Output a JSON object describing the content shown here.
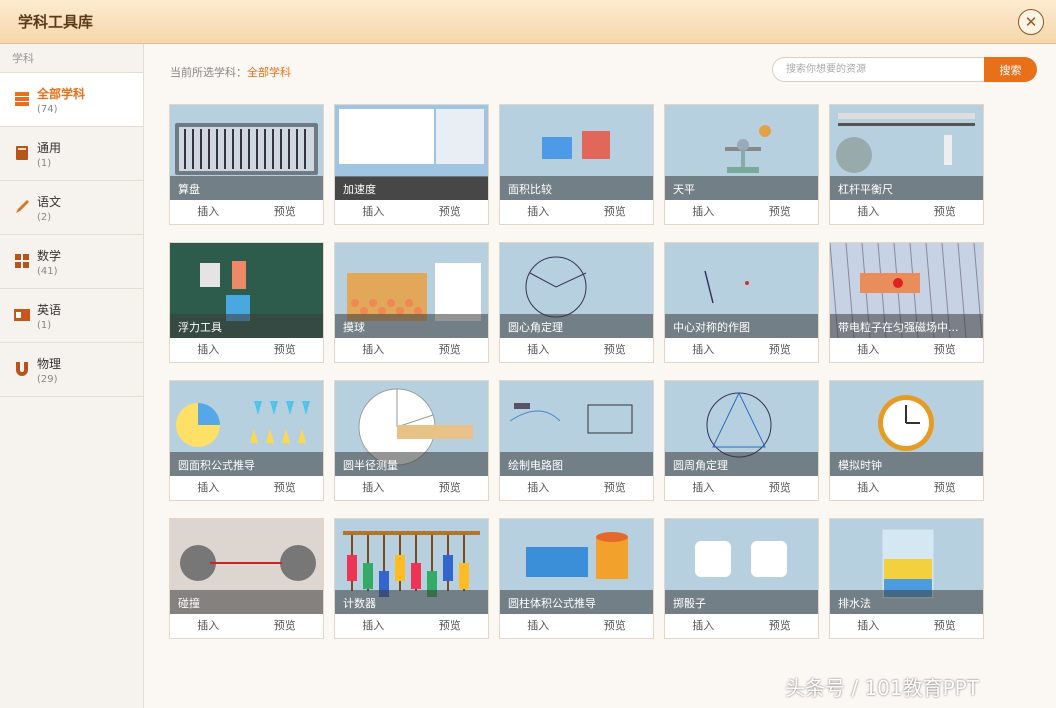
{
  "window": {
    "title": "学科工具库"
  },
  "sidebar": {
    "heading": "学科",
    "items": [
      {
        "label": "全部学科",
        "count": "(74)",
        "icon": "stack-icon"
      },
      {
        "label": "通用",
        "count": "(1)",
        "icon": "book-icon"
      },
      {
        "label": "语文",
        "count": "(2)",
        "icon": "pen-icon"
      },
      {
        "label": "数学",
        "count": "(41)",
        "icon": "calculator-icon"
      },
      {
        "label": "英语",
        "count": "(1)",
        "icon": "english-icon"
      },
      {
        "label": "物理",
        "count": "(29)",
        "icon": "magnet-icon"
      }
    ]
  },
  "breadcrumb": {
    "prefix": "当前所选学科：",
    "value": "全部学科"
  },
  "search": {
    "placeholder": "搜索你想要的资源",
    "button": "搜索"
  },
  "actions": {
    "insert": "插入",
    "preview": "预览"
  },
  "tools": [
    {
      "name": "算盘"
    },
    {
      "name": "加速度"
    },
    {
      "name": "面积比较"
    },
    {
      "name": "天平"
    },
    {
      "name": "杠杆平衡尺"
    },
    {
      "name": "浮力工具"
    },
    {
      "name": "摸球"
    },
    {
      "name": "圆心角定理"
    },
    {
      "name": "中心对称的作图"
    },
    {
      "name": "带电粒子在匀强磁场中..."
    },
    {
      "name": "圆面积公式推导"
    },
    {
      "name": "圆半径测量"
    },
    {
      "name": "绘制电路图"
    },
    {
      "name": "圆周角定理"
    },
    {
      "name": "模拟时钟"
    },
    {
      "name": "碰撞"
    },
    {
      "name": "计数器"
    },
    {
      "name": "圆柱体积公式推导"
    },
    {
      "name": "掷骰子"
    },
    {
      "name": "排水法"
    }
  ],
  "watermark": "头条号 / 101教育PPT",
  "colors": {
    "accent": "#e8701a",
    "titlebar": "#f6d7ab",
    "thumb_bg": "#b7d0e0"
  }
}
